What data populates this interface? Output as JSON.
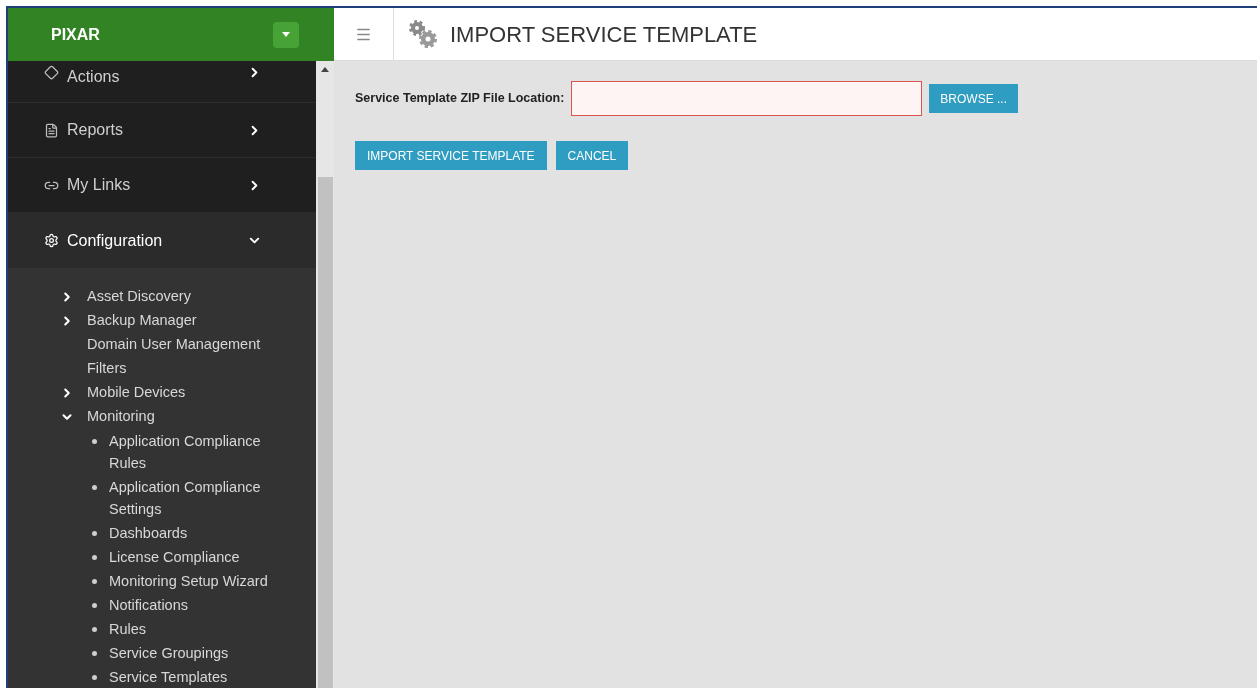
{
  "brand": {
    "title": "PIXAR"
  },
  "nav": [
    {
      "label": "Actions",
      "expanded": false
    },
    {
      "label": "Reports",
      "expanded": false
    },
    {
      "label": "My Links",
      "expanded": false
    },
    {
      "label": "Configuration",
      "expanded": true,
      "children": [
        {
          "label": "Asset Discovery",
          "kind": "group",
          "expanded": false
        },
        {
          "label": "Backup Manager",
          "kind": "group",
          "expanded": false
        },
        {
          "label": "Domain User Management",
          "kind": "link"
        },
        {
          "label": "Filters",
          "kind": "link"
        },
        {
          "label": "Mobile Devices",
          "kind": "group",
          "expanded": false
        },
        {
          "label": "Monitoring",
          "kind": "group",
          "expanded": true,
          "children": [
            {
              "label": "Application Compliance Rules",
              "kind": "bullet"
            },
            {
              "label": "Application Compliance Settings",
              "kind": "bullet"
            },
            {
              "label": "Dashboards",
              "kind": "bullet"
            },
            {
              "label": "License Compliance",
              "kind": "bullet"
            },
            {
              "label": "Monitoring Setup Wizard",
              "kind": "bullet"
            },
            {
              "label": "Notifications",
              "kind": "bullet"
            },
            {
              "label": "Rules",
              "kind": "bullet"
            },
            {
              "label": "Service Groupings",
              "kind": "bullet"
            },
            {
              "label": "Service Templates",
              "kind": "bullet"
            }
          ]
        }
      ]
    }
  ],
  "header": {
    "title": "IMPORT SERVICE TEMPLATE"
  },
  "form": {
    "label": "Service Template ZIP File Location:",
    "field": {
      "invalid": true
    },
    "browse_button": "BROWSE ..."
  },
  "buttons": [
    "IMPORT SERVICE TEMPLATE",
    "CANCEL"
  ]
}
